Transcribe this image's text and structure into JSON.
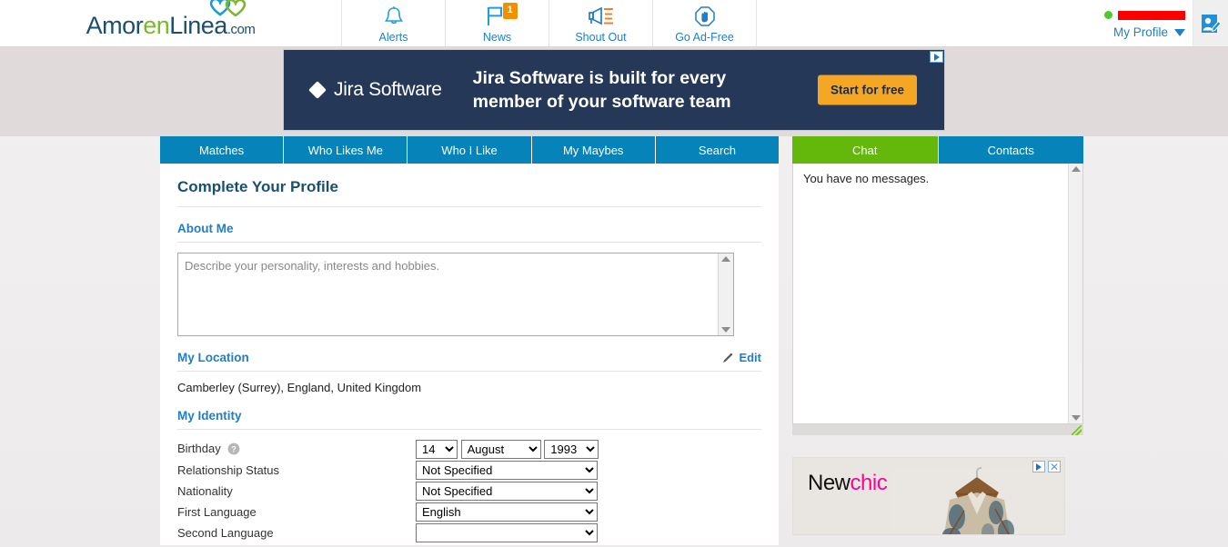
{
  "header": {
    "logo": {
      "part1": "Amor",
      "part2": "en",
      "part3": "Linea",
      "tld": ".com",
      "icon": "hearts-icon"
    },
    "nav": [
      {
        "label": "Alerts",
        "icon": "bell-icon",
        "badge": ""
      },
      {
        "label": "News",
        "icon": "flag-icon",
        "badge": "1"
      },
      {
        "label": "Shout Out",
        "icon": "megaphone-icon",
        "badge": ""
      },
      {
        "label": "Go Ad-Free",
        "icon": "stop-hand-icon",
        "badge": ""
      }
    ],
    "profile": {
      "username": "",
      "status": "online",
      "menu_label": "My Profile",
      "edit_icon": "profile-edit-icon"
    }
  },
  "leaderboard_ad": {
    "advertiser": "Jira Software",
    "headline": "Jira Software is built for every member of your software team",
    "cta": "Start for free",
    "adchoices": "adchoices-icon"
  },
  "tabs": [
    {
      "label": "Matches",
      "active": false
    },
    {
      "label": "Who Likes Me",
      "active": false
    },
    {
      "label": "Who I Like",
      "active": false
    },
    {
      "label": "My Maybes",
      "active": false
    },
    {
      "label": "Search",
      "active": false
    }
  ],
  "profile_page": {
    "title": "Complete Your Profile",
    "about": {
      "heading": "About Me",
      "placeholder": "Describe your personality, interests and hobbies.",
      "value": ""
    },
    "location": {
      "heading": "My Location",
      "edit_label": "Edit",
      "value": "Camberley (Surrey), England, United Kingdom"
    },
    "identity": {
      "heading": "My Identity",
      "rows": [
        {
          "label": "Birthday",
          "help": true,
          "type": "date",
          "day": "14",
          "month": "August",
          "year": "1993"
        },
        {
          "label": "Relationship Status",
          "help": false,
          "type": "select",
          "value": "Not Specified"
        },
        {
          "label": "Nationality",
          "help": false,
          "type": "select",
          "value": "Not Specified"
        },
        {
          "label": "First Language",
          "help": false,
          "type": "select",
          "value": "English"
        },
        {
          "label": "Second Language",
          "help": false,
          "type": "select",
          "value": ""
        }
      ]
    }
  },
  "sidebar": {
    "tabs": [
      {
        "label": "Chat",
        "active": true
      },
      {
        "label": "Contacts",
        "active": false
      }
    ],
    "chat_message": "You have no messages."
  },
  "sidebar_ad": {
    "brand_part1": "New",
    "brand_part2": "chic",
    "adchoices": "adchoices-icon",
    "close": "✕"
  },
  "colors": {
    "brand_blue": "#0683b8",
    "link_blue": "#1f7fc4",
    "dark_blue": "#1c4f6e",
    "green": "#64b70b",
    "orange": "#f09000",
    "ad_navy": "#253858",
    "ad_yellow": "#f5a623",
    "pink": "#ff0099"
  }
}
